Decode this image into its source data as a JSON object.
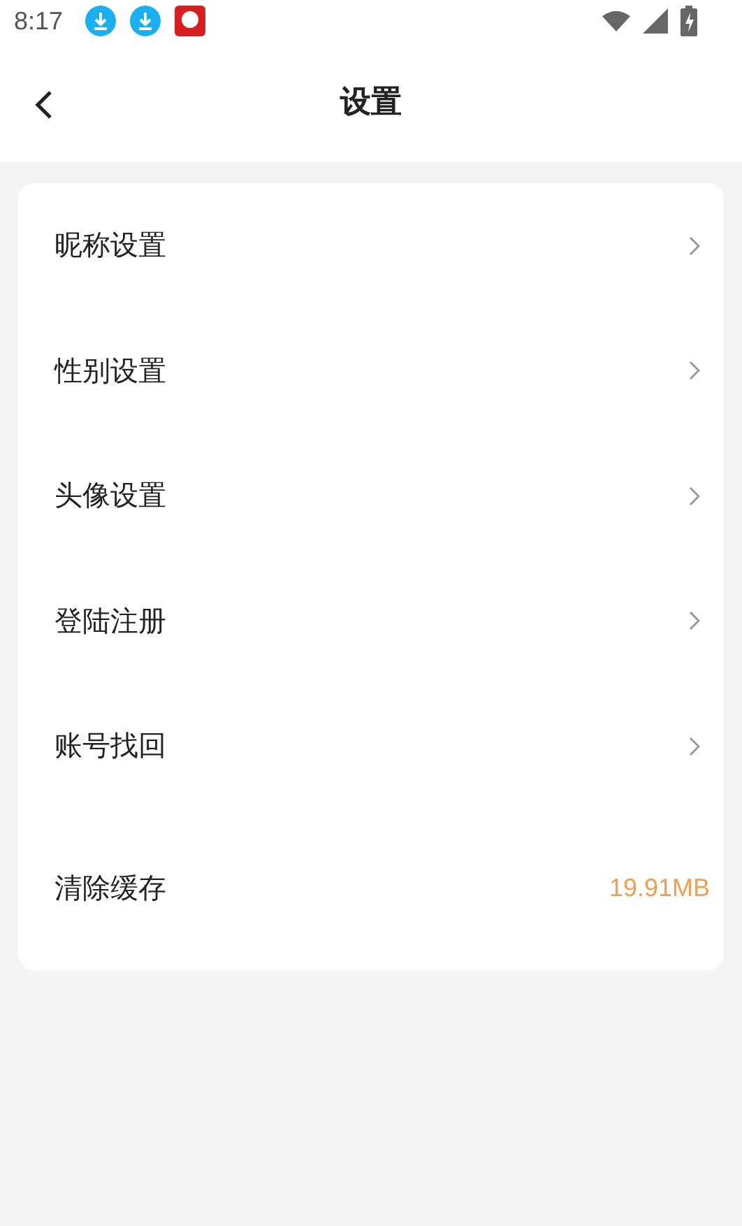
{
  "status_bar": {
    "time": "8:17"
  },
  "header": {
    "title": "设置"
  },
  "settings": [
    {
      "kind": "link",
      "label": "昵称设置"
    },
    {
      "kind": "link",
      "label": "性别设置"
    },
    {
      "kind": "link",
      "label": "头像设置"
    },
    {
      "kind": "link",
      "label": "登陆注册"
    },
    {
      "kind": "link",
      "label": "账号找回"
    },
    {
      "kind": "value",
      "label": "清除缓存",
      "value": "19.91MB"
    }
  ]
}
